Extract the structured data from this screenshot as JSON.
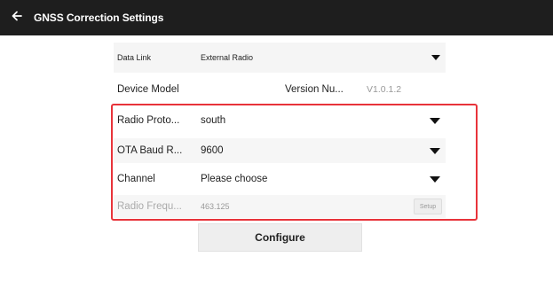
{
  "header": {
    "title": "GNSS Correction Settings",
    "back_icon": "arrow-left-icon"
  },
  "data_link": {
    "label": "Data Link",
    "value": "External Radio"
  },
  "device_info": {
    "model_label": "Device Model",
    "version_label": "Version Nu...",
    "version_value": "V1.0.1.2"
  },
  "radio_settings": {
    "protocol_label": "Radio Proto...",
    "protocol_value": "south",
    "baud_label": "OTA Baud R...",
    "baud_value": "9600",
    "channel_label": "Channel",
    "channel_value": "Please choose",
    "frequency_label": "Radio Frequ...",
    "frequency_value": "463.125",
    "setup_label": "Setup"
  },
  "actions": {
    "configure_label": "Configure"
  },
  "colors": {
    "topbar": "#1e1e1e",
    "highlight": "#e8333a"
  }
}
